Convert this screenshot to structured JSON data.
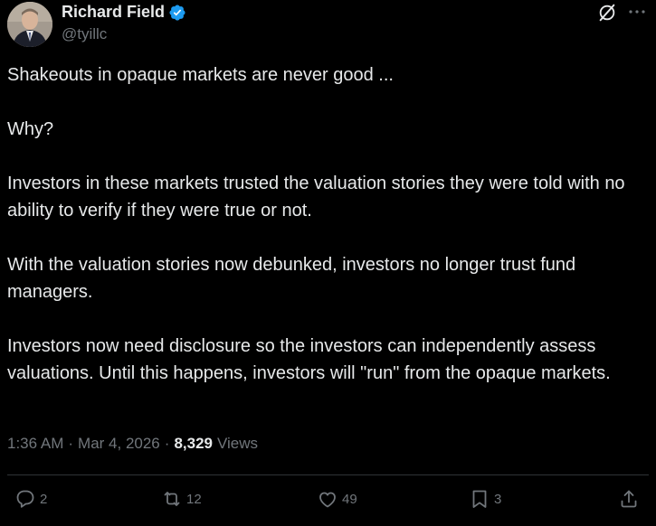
{
  "author": {
    "display_name": "Richard Field",
    "handle": "@tyillc",
    "verified_icon": "verified-badge-icon"
  },
  "header_icons": [
    "grok-icon",
    "more-icon"
  ],
  "post": {
    "paragraphs": [
      "Shakeouts in opaque markets are never good ...",
      "Why?",
      "Investors in these markets trusted the valuation stories they were told with no ability to verify if they were true or not.",
      "With the valuation stories now debunked, investors no longer trust fund managers.",
      "Investors now need disclosure so the investors can independently assess valuations.  Until this happens, investors will \"run\" from the opaque markets."
    ]
  },
  "meta": {
    "time": "1:36 AM",
    "date": "Mar 4, 2026",
    "views_count": "8,329",
    "views_label": "Views",
    "separator": "·"
  },
  "actions": {
    "replies": "2",
    "reposts": "12",
    "likes": "49",
    "bookmarks": "3"
  },
  "colors": {
    "background": "#000000",
    "text": "#e7e9ea",
    "muted": "#71767b",
    "verified": "#1d9bf0",
    "divider": "#2f3336"
  }
}
